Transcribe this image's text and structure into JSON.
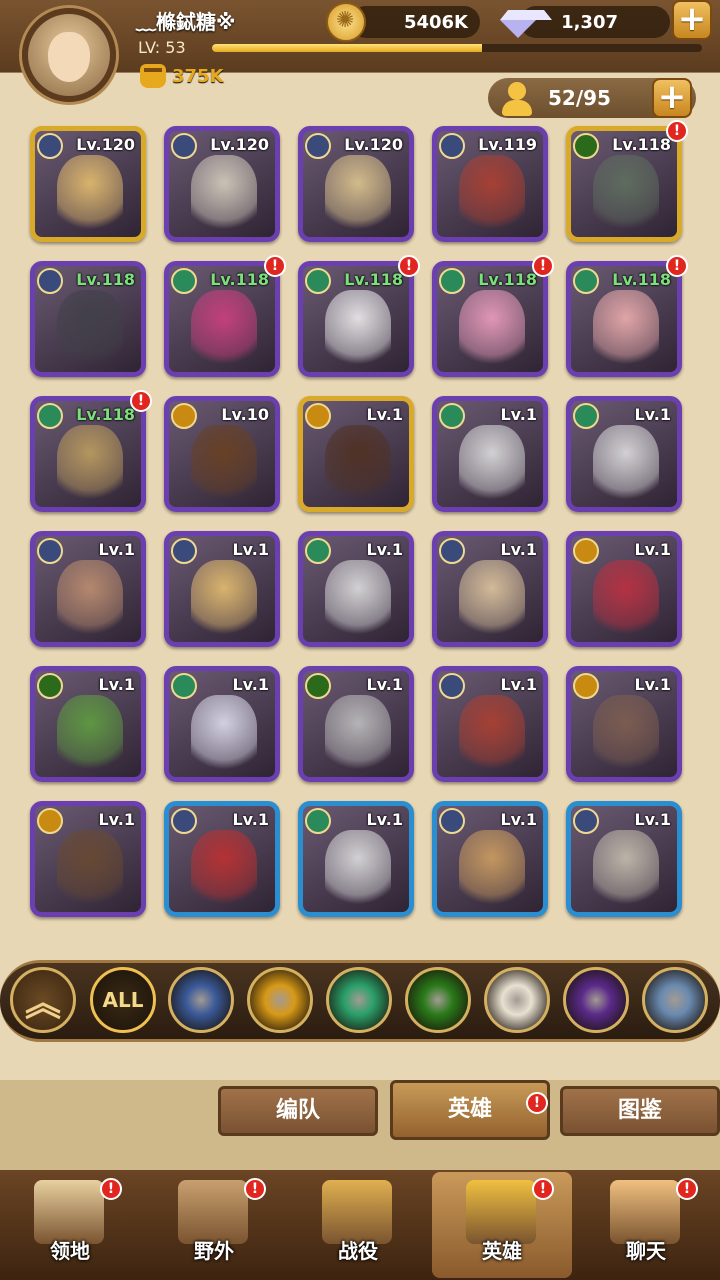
{
  "player": {
    "name": "﹏樤鋱糖※",
    "level_label": "LV: 53",
    "power": "375K",
    "xp_progress": 0.55
  },
  "resources": {
    "gold": "5406K",
    "gems": "1,307"
  },
  "roster": {
    "count": "52/95"
  },
  "heroes": [
    {
      "lv": "Lv.120",
      "faction": "lightbearer",
      "border": "gold",
      "color": "#e8c070",
      "alert": false,
      "green": false
    },
    {
      "lv": "Lv.120",
      "faction": "lightbearer",
      "border": "purple",
      "color": "#d8d0c0",
      "alert": false,
      "green": false
    },
    {
      "lv": "Lv.120",
      "faction": "lightbearer",
      "border": "purple",
      "color": "#e0c890",
      "alert": false,
      "green": false
    },
    {
      "lv": "Lv.119",
      "faction": "lightbearer",
      "border": "purple",
      "color": "#b04030",
      "alert": false,
      "green": false
    },
    {
      "lv": "Lv.118",
      "faction": "graveborn",
      "border": "gold",
      "color": "#607060",
      "alert": true,
      "green": false
    },
    {
      "lv": "Lv.118",
      "faction": "lightbearer",
      "border": "purple",
      "color": "#404048",
      "alert": false,
      "green": true
    },
    {
      "lv": "Lv.118",
      "faction": "wilder",
      "border": "purple",
      "color": "#d04080",
      "alert": true,
      "green": true
    },
    {
      "lv": "Lv.118",
      "faction": "wilder",
      "border": "purple",
      "color": "#f0f0f0",
      "alert": true,
      "green": true
    },
    {
      "lv": "Lv.118",
      "faction": "wilder",
      "border": "purple",
      "color": "#f0a0c0",
      "alert": true,
      "green": true
    },
    {
      "lv": "Lv.118",
      "faction": "wilder",
      "border": "purple",
      "color": "#f0b0b0",
      "alert": true,
      "green": true
    },
    {
      "lv": "Lv.118",
      "faction": "wilder",
      "border": "purple",
      "color": "#c0a060",
      "alert": true,
      "green": true
    },
    {
      "lv": "Lv.10",
      "faction": "mauler",
      "border": "purple",
      "color": "#6a4020",
      "alert": false,
      "green": false
    },
    {
      "lv": "Lv.1",
      "faction": "mauler",
      "border": "gold",
      "color": "#503020",
      "alert": false,
      "green": false
    },
    {
      "lv": "Lv.1",
      "faction": "wilder",
      "border": "purple",
      "color": "#e0e0e0",
      "alert": false,
      "green": false
    },
    {
      "lv": "Lv.1",
      "faction": "wilder",
      "border": "purple",
      "color": "#e0e0e0",
      "alert": false,
      "green": false
    },
    {
      "lv": "Lv.1",
      "faction": "lightbearer",
      "border": "purple",
      "color": "#c09070",
      "alert": false,
      "green": false
    },
    {
      "lv": "Lv.1",
      "faction": "lightbearer",
      "border": "purple",
      "color": "#e8c070",
      "alert": false,
      "green": false
    },
    {
      "lv": "Lv.1",
      "faction": "wilder",
      "border": "purple",
      "color": "#e0e0e0",
      "alert": false,
      "green": false
    },
    {
      "lv": "Lv.1",
      "faction": "lightbearer",
      "border": "purple",
      "color": "#e0c8a0",
      "alert": false,
      "green": false
    },
    {
      "lv": "Lv.1",
      "faction": "mauler",
      "border": "purple",
      "color": "#c03040",
      "alert": false,
      "green": false
    },
    {
      "lv": "Lv.1",
      "faction": "graveborn",
      "border": "purple",
      "color": "#60a040",
      "alert": false,
      "green": false
    },
    {
      "lv": "Lv.1",
      "faction": "wilder",
      "border": "purple",
      "color": "#e0e0f0",
      "alert": false,
      "green": false
    },
    {
      "lv": "Lv.1",
      "faction": "graveborn",
      "border": "purple",
      "color": "#c0c0c0",
      "alert": false,
      "green": false
    },
    {
      "lv": "Lv.1",
      "faction": "lightbearer",
      "border": "purple",
      "color": "#b04030",
      "alert": false,
      "green": false
    },
    {
      "lv": "Lv.1",
      "faction": "mauler",
      "border": "purple",
      "color": "#806050",
      "alert": false,
      "green": false
    },
    {
      "lv": "Lv.1",
      "faction": "mauler",
      "border": "purple",
      "color": "#6a4a30",
      "alert": false,
      "green": false
    },
    {
      "lv": "Lv.1",
      "faction": "lightbearer",
      "border": "blue",
      "color": "#c03030",
      "alert": false,
      "green": false
    },
    {
      "lv": "Lv.1",
      "faction": "wilder",
      "border": "blue",
      "color": "#e0e0e0",
      "alert": false,
      "green": false
    },
    {
      "lv": "Lv.1",
      "faction": "lightbearer",
      "border": "blue",
      "color": "#d0a060",
      "alert": false,
      "green": false
    },
    {
      "lv": "Lv.1",
      "faction": "lightbearer",
      "border": "blue",
      "color": "#c8c0b0",
      "alert": false,
      "green": false
    }
  ],
  "factions": {
    "lightbearer": "#3a4a7a",
    "mauler": "#c88a10",
    "wilder": "#2a8a5a",
    "graveborn": "#2a6a1a"
  },
  "filters": [
    {
      "id": "up",
      "icon": "chevron-up-icon"
    },
    {
      "id": "all",
      "label": "ALL"
    },
    {
      "id": "lightbearer",
      "icon": "lightbearer-icon",
      "color": "#3a5a9a"
    },
    {
      "id": "mauler",
      "icon": "mauler-icon",
      "color": "#d89a18"
    },
    {
      "id": "wilder",
      "icon": "wilder-icon",
      "color": "#2aa06a"
    },
    {
      "id": "graveborn",
      "icon": "graveborn-icon",
      "color": "#2a7a1a"
    },
    {
      "id": "celestial",
      "icon": "celestial-icon",
      "color": "#e8e0d0"
    },
    {
      "id": "hypogean",
      "icon": "hypogean-icon",
      "color": "#5a2a8a"
    },
    {
      "id": "dimensional",
      "icon": "dimensional-icon",
      "color": "#6a8ab0"
    }
  ],
  "tabs": [
    "编队",
    "英雄",
    "图鉴"
  ],
  "nav": [
    {
      "label": "领地",
      "icon": "castle-icon",
      "alert": true
    },
    {
      "label": "野外",
      "icon": "scroll-map-icon",
      "alert": true
    },
    {
      "label": "战役",
      "icon": "sword-shield-icon",
      "alert": false
    },
    {
      "label": "英雄",
      "icon": "helmet-icon",
      "alert": true
    },
    {
      "label": "聊天",
      "icon": "chat-bubble-icon",
      "alert": true
    }
  ]
}
